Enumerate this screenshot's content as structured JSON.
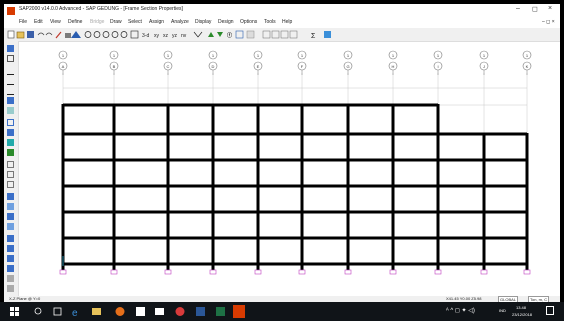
{
  "window": {
    "title": "SAP2000 v14.0.0 Advanced  - SAP GEDUNG - [Frame Section Properties]",
    "minimize": "–",
    "maximize": "◻",
    "close": "×",
    "doc_controls": "– ◻ ×"
  },
  "menu": {
    "items": [
      "File",
      "Edit",
      "View",
      "Define",
      "Bridge",
      "Draw",
      "Select",
      "Assign",
      "Analyze",
      "Display",
      "Design",
      "Options",
      "Tools",
      "Help"
    ]
  },
  "toolbar": {
    "icons": [
      "new-icon",
      "open-icon",
      "save-icon",
      "undo-icon",
      "redo-icon",
      "pencil-icon",
      "lock-icon",
      "run-icon",
      "zoom-in-icon",
      "zoom-out-icon",
      "zoom-window-icon",
      "zoom-full-icon",
      "pan-icon",
      "refresh-icon",
      "3d-view-icon",
      "xy-view-icon",
      "xz-view-icon",
      "yz-view-icon",
      "nv-view-icon",
      "rotate-icon",
      "up-icon",
      "down-icon",
      "select-all-icon",
      "grid-icon",
      "section-icon",
      "frame-icon",
      "shell-icon",
      "link-icon",
      "joint-icon",
      "sum-icon",
      "color-icon"
    ],
    "text_labels": [
      "3-d",
      "xy",
      "xz",
      "yz",
      "nv"
    ]
  },
  "left_toolbar": {
    "icons": [
      "pointer-icon",
      "reshape-icon",
      "draw-frame-icon",
      "quick-draw-icon",
      "draw-brace-icon",
      "draw-area-icon",
      "draw-rect-icon",
      "draw-quad-icon",
      "draw-special-icon",
      "draw-link-icon",
      "draw-joint-icon",
      "select-box-icon",
      "select-poly-icon",
      "select-intersect-icon",
      "restraint-fixed-icon",
      "restraint-pin-icon",
      "restraint-roller-icon",
      "restraint-free-icon",
      "snap-joint-icon",
      "snap-line-icon",
      "snap-mid-icon",
      "snap-intersect-icon",
      "snap-perp-icon",
      "snap-grid-icon"
    ]
  },
  "grid": {
    "labels": [
      "1",
      "A",
      "B",
      "C",
      "D",
      "E",
      "F",
      "G",
      "H",
      "I",
      "J",
      "K"
    ]
  },
  "status": {
    "plane": "X-Z Plane @ Y=0",
    "coords": "X41.45  Y0.00  Z5.98",
    "coord_system": "GLOBAL",
    "units": "Ton, m, C"
  },
  "taskbar": {
    "time": "13.48",
    "date": "23/12/2018",
    "lang": "IND",
    "apps": [
      "start-icon",
      "search-icon",
      "task-view-icon",
      "edge-icon",
      "explorer-icon",
      "firefox-icon",
      "store-icon",
      "mail-icon",
      "chrome-icon",
      "word-icon",
      "excel-icon",
      "sap2000-icon"
    ]
  },
  "colors": {
    "frame": "#000000",
    "grid": "#c8c8c8",
    "accent": "#d83b01",
    "support": "#c040c0",
    "bubble": "#777777"
  }
}
